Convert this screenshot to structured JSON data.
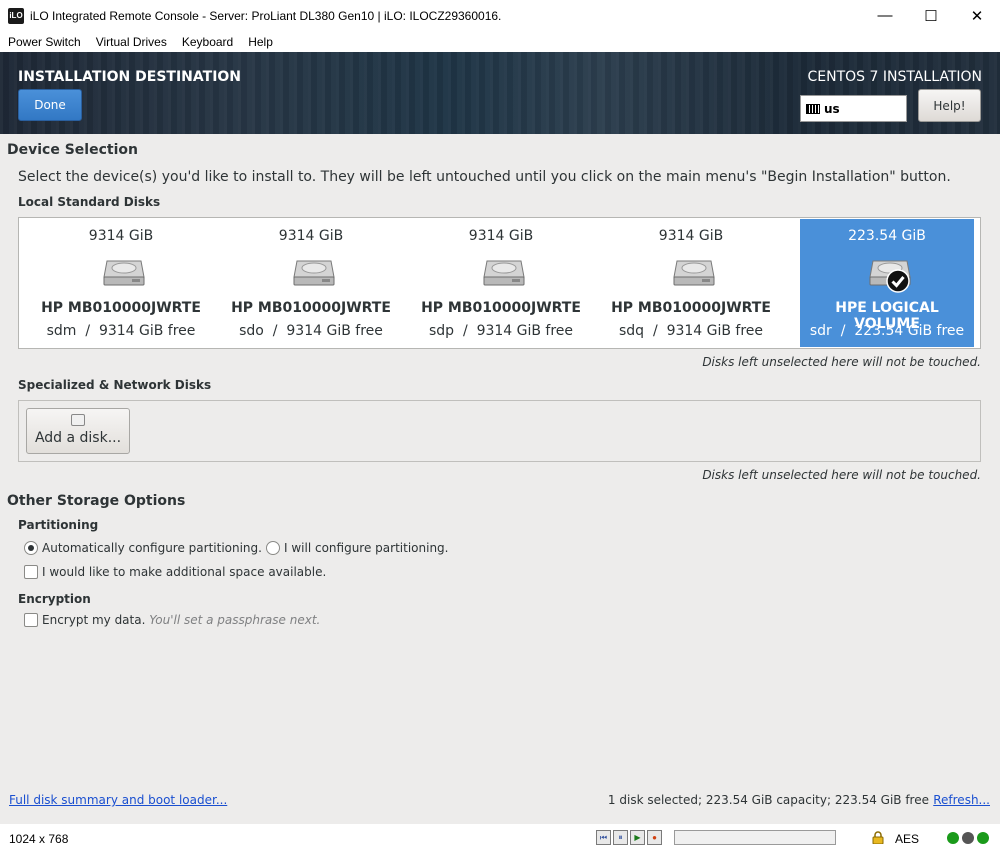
{
  "window": {
    "app_icon_text": "iLO",
    "title": "iLO Integrated Remote Console - Server: ProLiant DL380 Gen10 | iLO: ILOCZ29360016.",
    "minimize": "—",
    "maximize": "☐",
    "close": "✕"
  },
  "menu": [
    "Power Switch",
    "Virtual Drives",
    "Keyboard",
    "Help"
  ],
  "header": {
    "title": "INSTALLATION DESTINATION",
    "done_label": "Done",
    "product": "CENTOS 7 INSTALLATION",
    "keyboard_layout": "us",
    "help_label": "Help!"
  },
  "device_selection": {
    "heading": "Device Selection",
    "instructions": "Select the device(s) you'd like to install to.  They will be left untouched until you click on the main menu's \"Begin Installation\" button.",
    "local_heading": "Local Standard Disks",
    "disks": [
      {
        "capacity": "9314 GiB",
        "model": "HP MB010000JWRTE",
        "device": "sdm",
        "free": "9314 GiB free",
        "selected": false
      },
      {
        "capacity": "9314 GiB",
        "model": "HP MB010000JWRTE",
        "device": "sdo",
        "free": "9314 GiB free",
        "selected": false
      },
      {
        "capacity": "9314 GiB",
        "model": "HP MB010000JWRTE",
        "device": "sdp",
        "free": "9314 GiB free",
        "selected": false
      },
      {
        "capacity": "9314 GiB",
        "model": "HP MB010000JWRTE",
        "device": "sdq",
        "free": "9314 GiB free",
        "selected": false
      },
      {
        "capacity": "223.54 GiB",
        "model": "HPE LOGICAL VOLUME",
        "device": "sdr",
        "free": "223.54 GiB free",
        "selected": true
      }
    ],
    "separator": "/",
    "untouched_note": "Disks left unselected here will not be touched.",
    "specialized_heading": "Specialized & Network Disks",
    "add_disk_label": "Add a disk...",
    "untouched_note_2": "Disks left unselected here will not be touched."
  },
  "other_storage": {
    "heading": "Other Storage Options",
    "partitioning_heading": "Partitioning",
    "auto_partition": "Automatically configure partitioning.",
    "manual_partition": "I will configure partitioning.",
    "partition_mode": "auto",
    "additional_space": "I would like to make additional space available.",
    "additional_space_checked": false,
    "encryption_heading": "Encryption",
    "encrypt_label": "Encrypt my data.",
    "encrypt_hint": "You'll set a passphrase next.",
    "encrypt_checked": false
  },
  "footer": {
    "summary_link": "Full disk summary and boot loader...",
    "status": "1 disk selected; 223.54 GiB capacity; 223.54 GiB free",
    "refresh_link": "Refresh..."
  },
  "statusbar": {
    "resolution": "1024 x 768",
    "encryption": "AES"
  },
  "colors": {
    "selected_disk": "#4a90d9",
    "done_button": "#3f85d1",
    "link": "#1a4fd0"
  }
}
